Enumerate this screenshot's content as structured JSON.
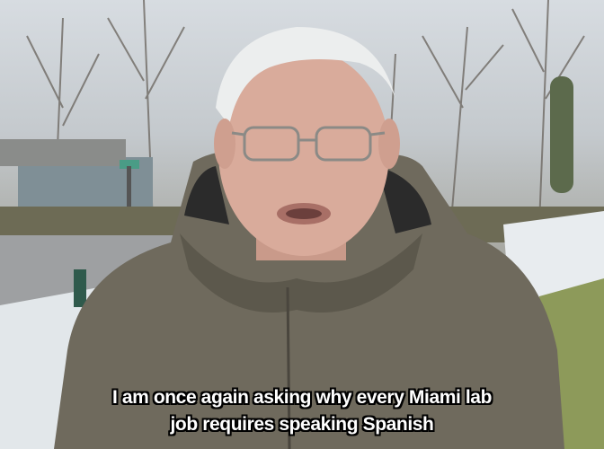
{
  "caption": {
    "line1": "I am once again asking why every Miami lab",
    "line2": "job requires speaking Spanish"
  },
  "colors": {
    "sky": "#d7dce1",
    "jacket": "#6f6a5d",
    "grass": "#8d9a5a",
    "snow": "#e8ecef",
    "text": "#ffffff",
    "text_outline": "#000000"
  }
}
